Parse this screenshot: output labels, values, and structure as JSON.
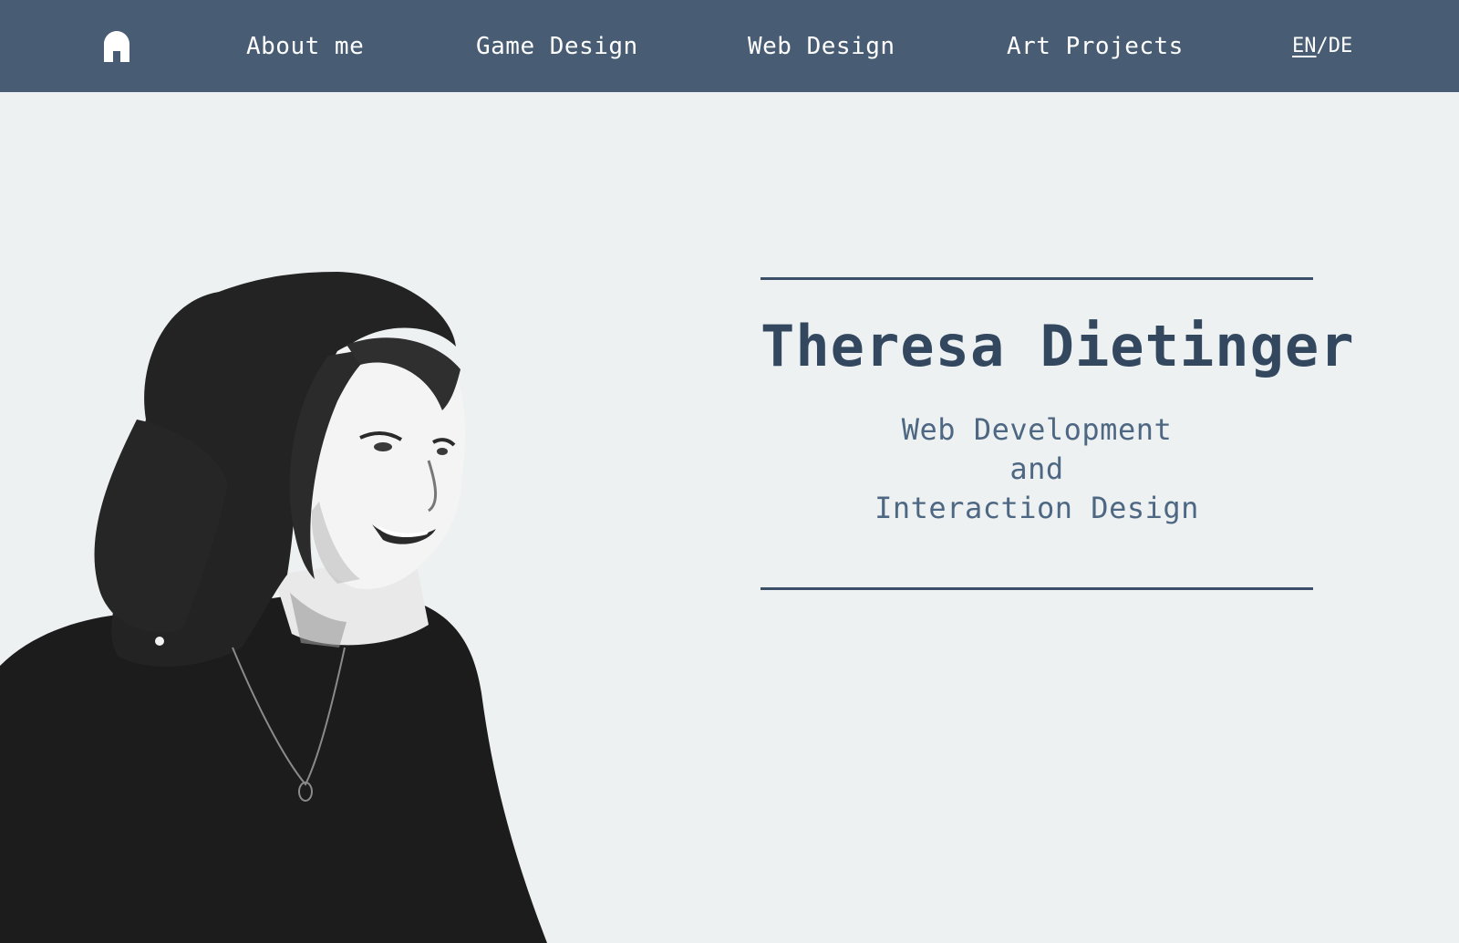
{
  "nav": {
    "home_icon": "home-icon",
    "links": [
      "About me",
      "Game Design",
      "Web Design",
      "Art Projects"
    ],
    "lang": {
      "active": "EN",
      "separator": "/",
      "other": "DE"
    }
  },
  "hero": {
    "name": "Theresa Dietinger",
    "subtitle_lines": [
      "Web Development",
      "and",
      "Interaction Design"
    ]
  },
  "colors": {
    "navbar": "#485d73",
    "background": "#edf1f2",
    "title": "#33485f",
    "subtitle": "#4e6782",
    "rule": "#3b5068"
  }
}
